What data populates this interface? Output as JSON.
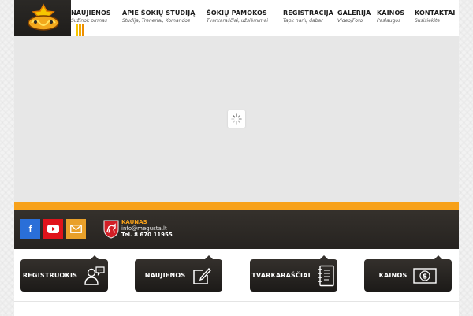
{
  "nav": {
    "items": [
      {
        "title": "NAUJIENOS",
        "subtitle": "Sužinok pirmas"
      },
      {
        "title": "APIE ŠOKIŲ STUDIJĄ",
        "subtitle": "Studija, Treneriai, Komandos"
      },
      {
        "title": "ŠOKIŲ PAMOKOS",
        "subtitle": "Tvarkaraščiai, užsiėmimai"
      },
      {
        "title": "REGISTRACIJA",
        "subtitle": "Tapk narių dabar"
      },
      {
        "title": "GALERIJA",
        "subtitle": "Video/Foto"
      },
      {
        "title": "KAINOS",
        "subtitle": "Paslaugos"
      },
      {
        "title": "KONTAKTAI",
        "subtitle": "Susisiekite"
      }
    ]
  },
  "contact": {
    "city": "KAUNAS",
    "email": "info@megusta.lt",
    "phone": "Tel. 8 670 11955"
  },
  "social": {
    "facebook_glyph": "f",
    "icons": [
      "facebook-icon",
      "youtube-icon",
      "email-icon"
    ]
  },
  "features": [
    {
      "label": "REGISTRUOKIS",
      "icon": "user-chat-icon"
    },
    {
      "label": "NAUJIENOS",
      "icon": "edit-note-icon"
    },
    {
      "label": "TVARKARAŠČIAI",
      "icon": "notebook-icon"
    },
    {
      "label": "KAINOS",
      "icon": "dollar-bill-icon"
    }
  ],
  "colors": {
    "accent_orange": "#f7a11a",
    "header_dark": "#2b2926",
    "facebook": "#2a6fd8",
    "youtube": "#e0141b",
    "email": "#e9a02a"
  }
}
